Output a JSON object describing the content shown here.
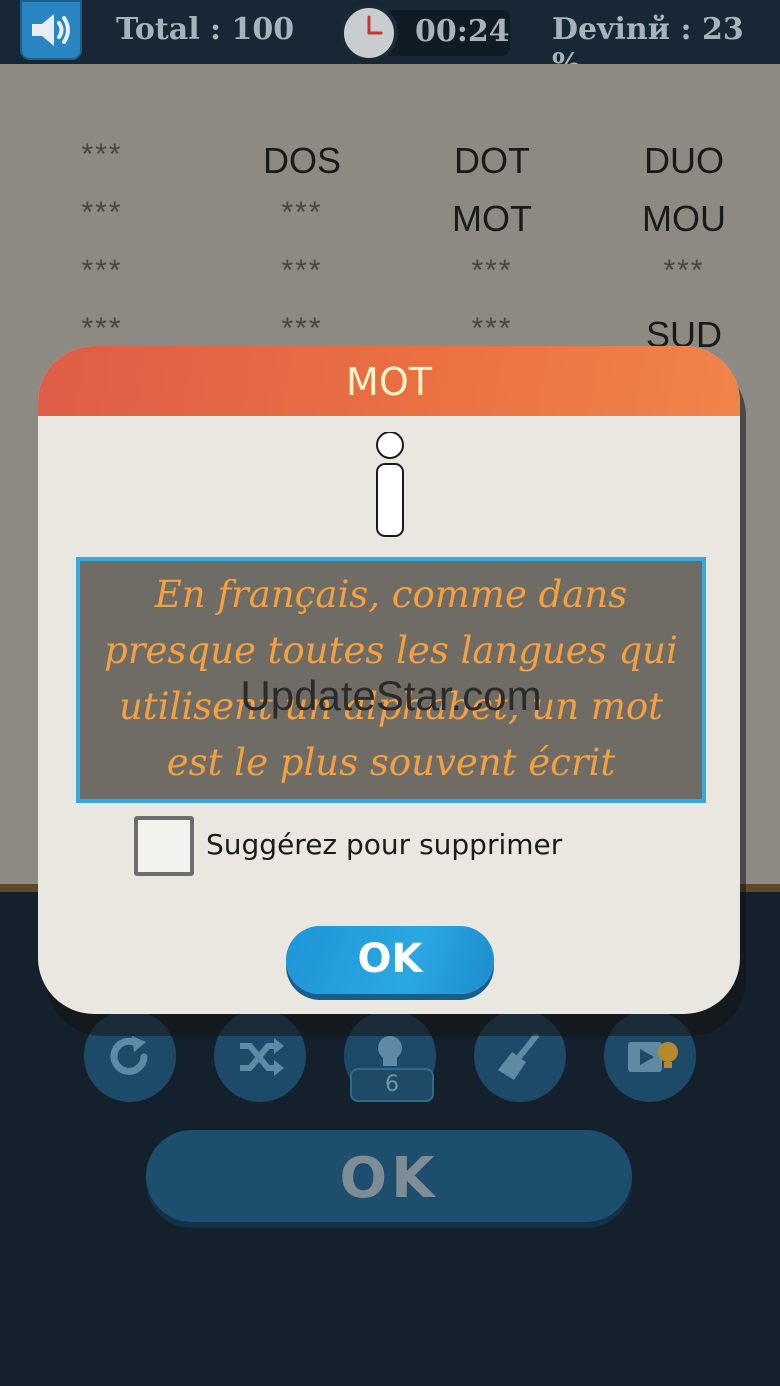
{
  "header": {
    "total": "Total : 100",
    "timer": "00:24",
    "guessed": "Devinй : 23 %"
  },
  "board": {
    "rows": [
      [
        "***",
        "DOS",
        "DOT",
        "DUO"
      ],
      [
        "***",
        "***",
        "MOT",
        "MOU"
      ],
      [
        "***",
        "***",
        "***",
        "***"
      ],
      [
        "***",
        "***",
        "***",
        "SUD"
      ]
    ]
  },
  "modal": {
    "title": "MOT",
    "description": "En français, comme dans presque toutes les langues qui utilisent un alphabet, un mot est le plus souvent écrit",
    "watermark": "UpdateStar.com",
    "checkbox_label": "Suggérez pour supprimer",
    "ok_label": "OK"
  },
  "controls": {
    "hint_count": "6",
    "ok_label": "OK"
  },
  "icons": [
    "speaker-icon",
    "clock-icon",
    "info-icon",
    "refresh-icon",
    "shuffle-icon",
    "lightbulb-icon",
    "broom-icon",
    "video-hint-icon"
  ],
  "colors": {
    "accent_blue": "#2aa7e2",
    "modal_header": "#ea7042",
    "description_text": "#f4a040"
  }
}
